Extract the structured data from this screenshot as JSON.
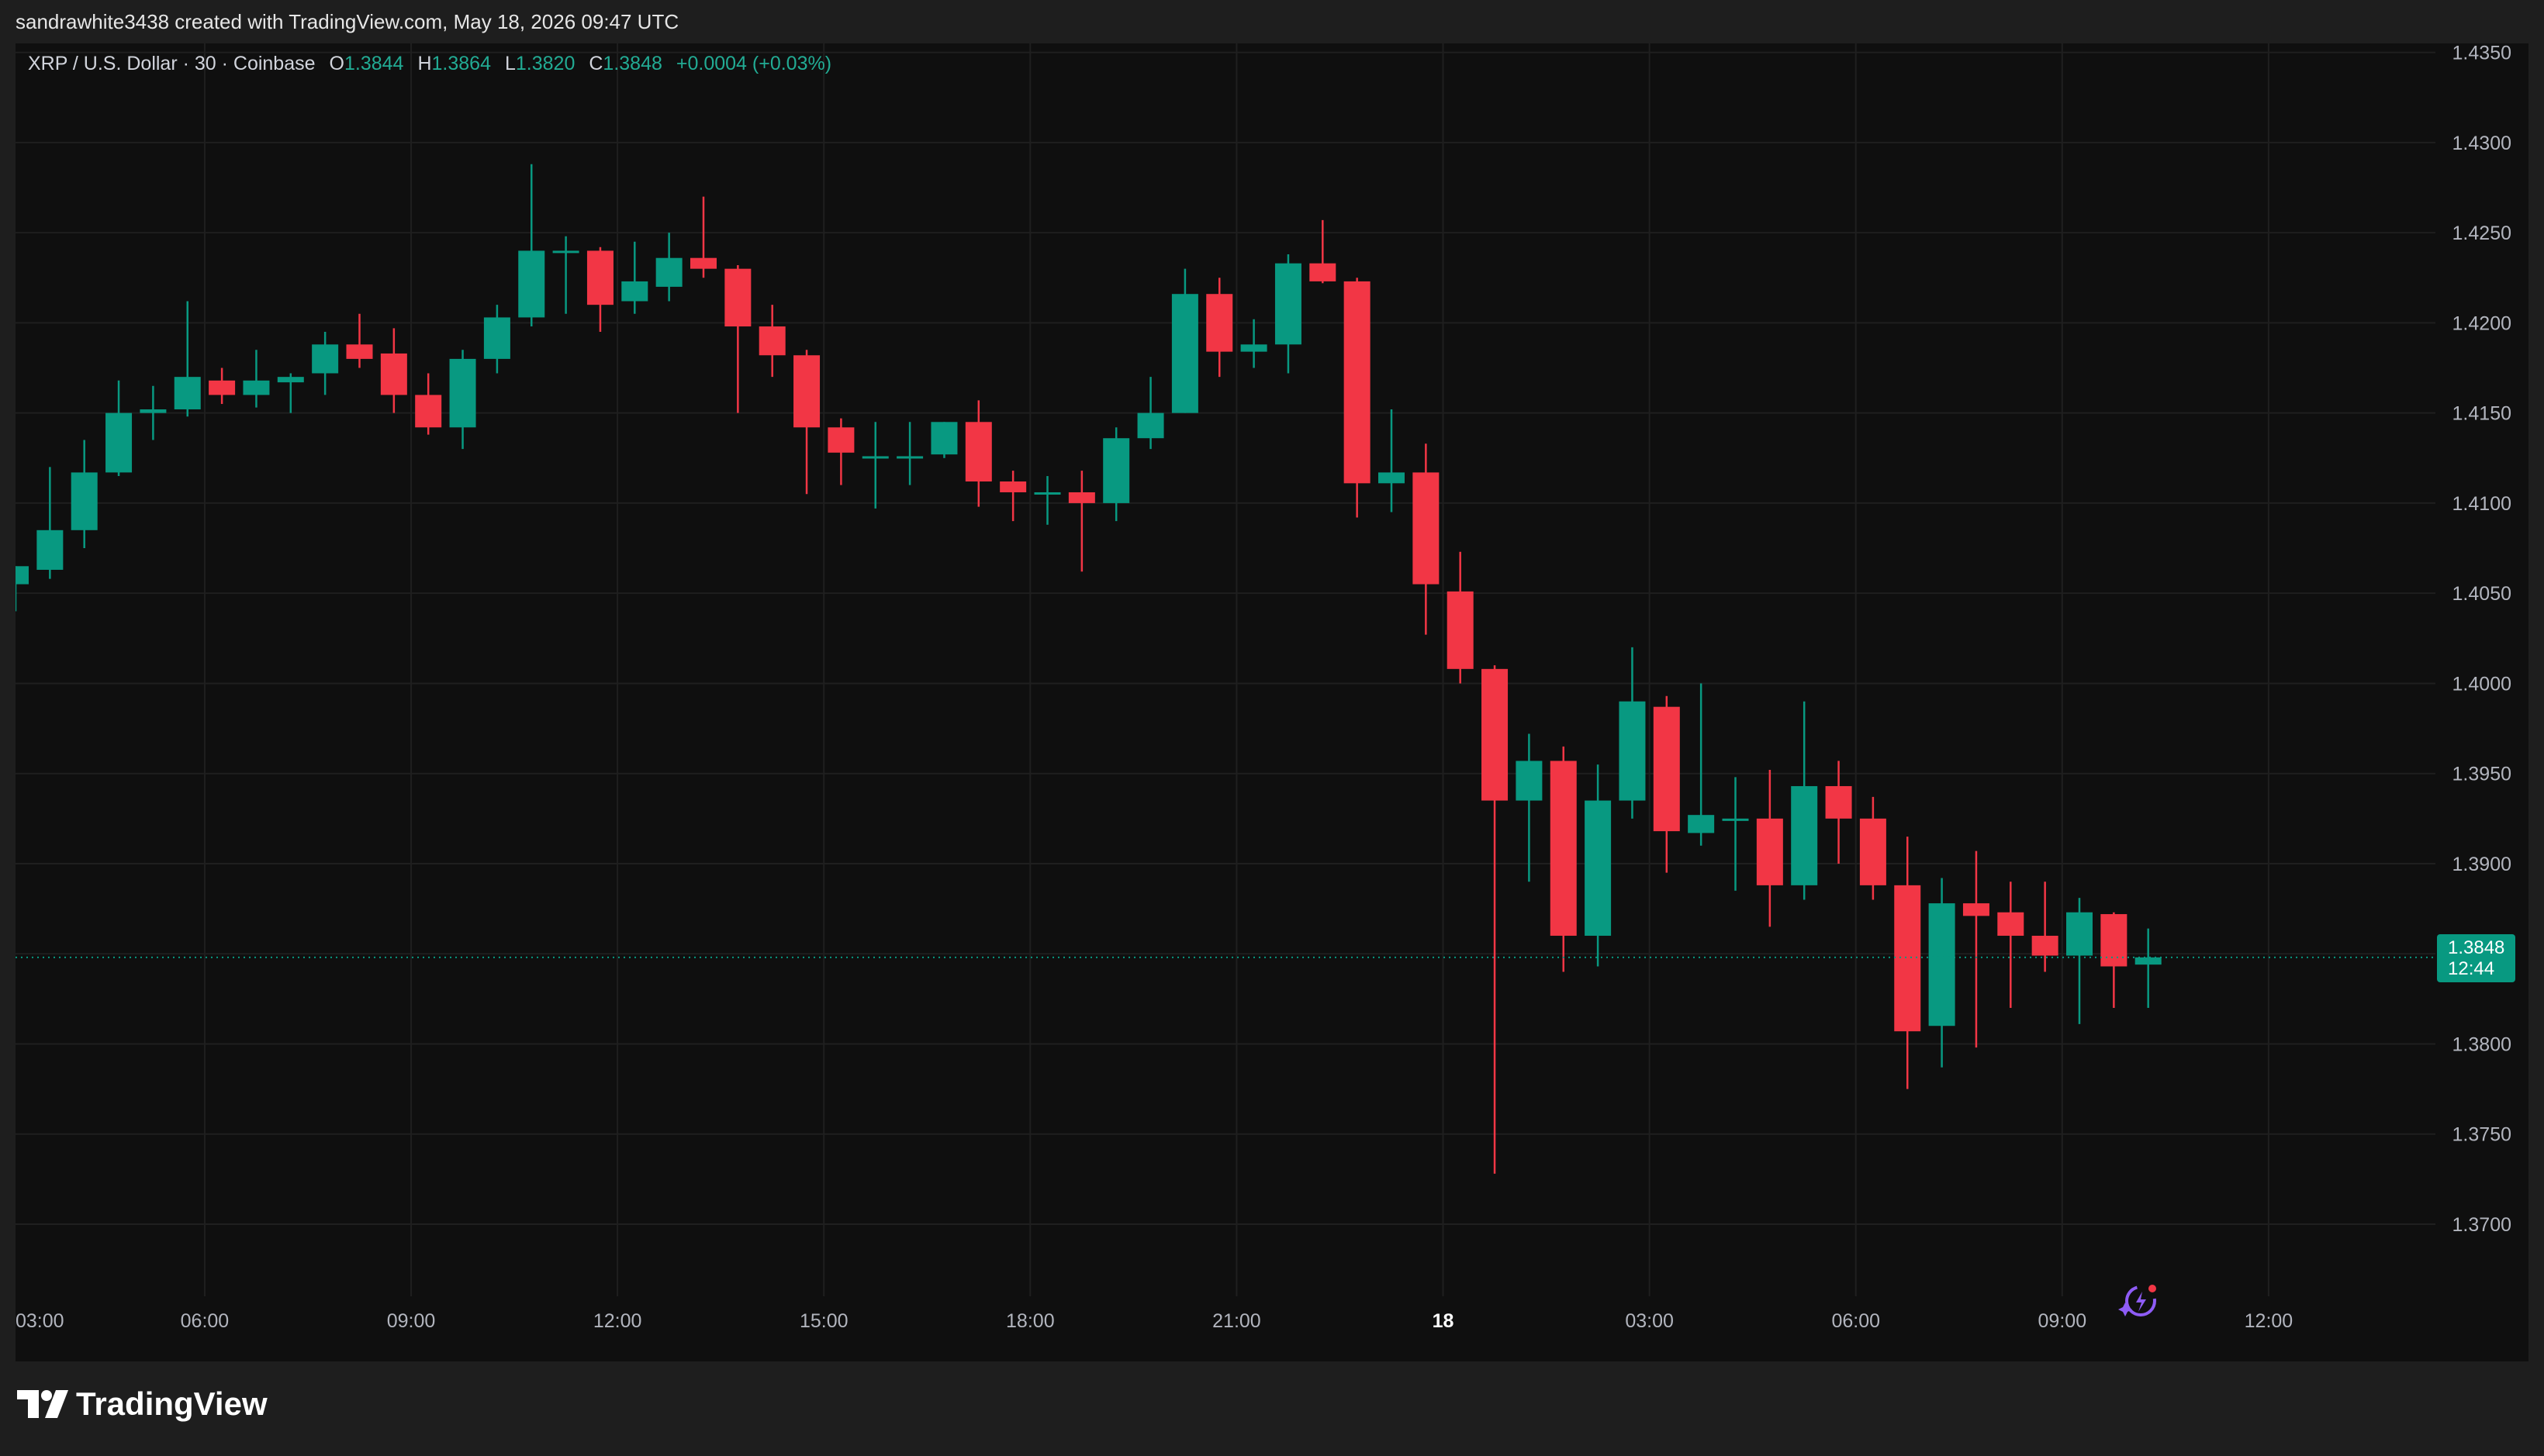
{
  "header": {
    "credit": "sandrawhite3438 created with TradingView.com, May 18, 2026 09:47 UTC"
  },
  "legend": {
    "symbol": "XRP / U.S. Dollar · 30 · Coinbase",
    "open_label": "O",
    "open": "1.3844",
    "high_label": "H",
    "high": "1.3864",
    "low_label": "L",
    "low": "1.3820",
    "close_label": "C",
    "close": "1.3848",
    "change": "+0.0004 (+0.03%)"
  },
  "price_tag": {
    "price": "1.3848",
    "countdown": "12:44"
  },
  "branding": {
    "logo_text": "TradingView"
  },
  "colors": {
    "up": "#089981",
    "down": "#f23645",
    "background": "#0f0f0f",
    "grid": "#1f1f1f",
    "axis_text": "#b2b5be"
  },
  "chart_data": {
    "type": "candlestick",
    "interval_minutes": 30,
    "y_ticks": [
      "1.4350",
      "1.4300",
      "1.4250",
      "1.4200",
      "1.4150",
      "1.4100",
      "1.4050",
      "1.4000",
      "1.3950",
      "1.3900",
      "1.3850",
      "1.3800",
      "1.3750",
      "1.3700"
    ],
    "ylim": [
      1.366,
      1.4355
    ],
    "x_tick_labels": [
      {
        "label": "03:00",
        "slot": -1
      },
      {
        "label": "06:00",
        "slot": 5
      },
      {
        "label": "09:00",
        "slot": 11
      },
      {
        "label": "12:00",
        "slot": 17
      },
      {
        "label": "15:00",
        "slot": 23
      },
      {
        "label": "18:00",
        "slot": 29
      },
      {
        "label": "21:00",
        "slot": 35
      },
      {
        "label": "18",
        "slot": 41,
        "bold": true
      },
      {
        "label": "03:00",
        "slot": 47
      },
      {
        "label": "06:00",
        "slot": 53
      },
      {
        "label": "09:00",
        "slot": 59
      },
      {
        "label": "12:00",
        "slot": 65
      }
    ],
    "candles": [
      {
        "o": 1.4055,
        "h": 1.4065,
        "l": 1.404,
        "c": 1.4065
      },
      {
        "o": 1.4063,
        "h": 1.412,
        "l": 1.4058,
        "c": 1.4085
      },
      {
        "o": 1.4085,
        "h": 1.4135,
        "l": 1.4075,
        "c": 1.4117
      },
      {
        "o": 1.4117,
        "h": 1.4168,
        "l": 1.4115,
        "c": 1.415
      },
      {
        "o": 1.415,
        "h": 1.4165,
        "l": 1.4135,
        "c": 1.4152
      },
      {
        "o": 1.4152,
        "h": 1.4212,
        "l": 1.4148,
        "c": 1.417
      },
      {
        "o": 1.4168,
        "h": 1.4175,
        "l": 1.4155,
        "c": 1.416
      },
      {
        "o": 1.416,
        "h": 1.4185,
        "l": 1.4153,
        "c": 1.4168
      },
      {
        "o": 1.4167,
        "h": 1.4172,
        "l": 1.415,
        "c": 1.417
      },
      {
        "o": 1.4172,
        "h": 1.4195,
        "l": 1.416,
        "c": 1.4188
      },
      {
        "o": 1.4188,
        "h": 1.4205,
        "l": 1.4175,
        "c": 1.418
      },
      {
        "o": 1.4183,
        "h": 1.4197,
        "l": 1.415,
        "c": 1.416
      },
      {
        "o": 1.416,
        "h": 1.4172,
        "l": 1.4138,
        "c": 1.4142
      },
      {
        "o": 1.4142,
        "h": 1.4185,
        "l": 1.413,
        "c": 1.418
      },
      {
        "o": 1.418,
        "h": 1.421,
        "l": 1.4172,
        "c": 1.4203
      },
      {
        "o": 1.4203,
        "h": 1.4288,
        "l": 1.4198,
        "c": 1.424
      },
      {
        "o": 1.424,
        "h": 1.4248,
        "l": 1.4205,
        "c": 1.424
      },
      {
        "o": 1.424,
        "h": 1.4242,
        "l": 1.4195,
        "c": 1.421
      },
      {
        "o": 1.4212,
        "h": 1.4245,
        "l": 1.4205,
        "c": 1.4223
      },
      {
        "o": 1.422,
        "h": 1.425,
        "l": 1.4212,
        "c": 1.4236
      },
      {
        "o": 1.4236,
        "h": 1.427,
        "l": 1.4225,
        "c": 1.423
      },
      {
        "o": 1.423,
        "h": 1.4232,
        "l": 1.415,
        "c": 1.4198
      },
      {
        "o": 1.4198,
        "h": 1.421,
        "l": 1.417,
        "c": 1.4182
      },
      {
        "o": 1.4182,
        "h": 1.4185,
        "l": 1.4105,
        "c": 1.4142
      },
      {
        "o": 1.4142,
        "h": 1.4147,
        "l": 1.411,
        "c": 1.4128
      },
      {
        "o": 1.4126,
        "h": 1.4145,
        "l": 1.4097,
        "c": 1.4126
      },
      {
        "o": 1.4126,
        "h": 1.4145,
        "l": 1.411,
        "c": 1.4126
      },
      {
        "o": 1.4127,
        "h": 1.4145,
        "l": 1.4125,
        "c": 1.4145
      },
      {
        "o": 1.4145,
        "h": 1.4157,
        "l": 1.4098,
        "c": 1.4112
      },
      {
        "o": 1.4112,
        "h": 1.4118,
        "l": 1.409,
        "c": 1.4106
      },
      {
        "o": 1.4106,
        "h": 1.4115,
        "l": 1.4088,
        "c": 1.4106
      },
      {
        "o": 1.4106,
        "h": 1.4118,
        "l": 1.4062,
        "c": 1.41
      },
      {
        "o": 1.41,
        "h": 1.4142,
        "l": 1.409,
        "c": 1.4136
      },
      {
        "o": 1.4136,
        "h": 1.417,
        "l": 1.413,
        "c": 1.415
      },
      {
        "o": 1.415,
        "h": 1.423,
        "l": 1.415,
        "c": 1.4216
      },
      {
        "o": 1.4216,
        "h": 1.4225,
        "l": 1.417,
        "c": 1.4184
      },
      {
        "o": 1.4184,
        "h": 1.4202,
        "l": 1.4175,
        "c": 1.4188
      },
      {
        "o": 1.4188,
        "h": 1.4238,
        "l": 1.4172,
        "c": 1.4233
      },
      {
        "o": 1.4233,
        "h": 1.4257,
        "l": 1.4222,
        "c": 1.4223
      },
      {
        "o": 1.4223,
        "h": 1.4225,
        "l": 1.4092,
        "c": 1.4111
      },
      {
        "o": 1.4111,
        "h": 1.4152,
        "l": 1.4095,
        "c": 1.4117
      },
      {
        "o": 1.4117,
        "h": 1.4133,
        "l": 1.4027,
        "c": 1.4055
      },
      {
        "o": 1.4051,
        "h": 1.4073,
        "l": 1.4,
        "c": 1.4008
      },
      {
        "o": 1.4008,
        "h": 1.401,
        "l": 1.3728,
        "c": 1.3935
      },
      {
        "o": 1.3935,
        "h": 1.3972,
        "l": 1.389,
        "c": 1.3957
      },
      {
        "o": 1.3957,
        "h": 1.3965,
        "l": 1.384,
        "c": 1.386
      },
      {
        "o": 1.386,
        "h": 1.3955,
        "l": 1.3843,
        "c": 1.3935
      },
      {
        "o": 1.3935,
        "h": 1.402,
        "l": 1.3925,
        "c": 1.399
      },
      {
        "o": 1.3987,
        "h": 1.3993,
        "l": 1.3895,
        "c": 1.3918
      },
      {
        "o": 1.3917,
        "h": 1.4,
        "l": 1.391,
        "c": 1.3927
      },
      {
        "o": 1.3925,
        "h": 1.3948,
        "l": 1.3885,
        "c": 1.3925
      },
      {
        "o": 1.3925,
        "h": 1.3952,
        "l": 1.3865,
        "c": 1.3888
      },
      {
        "o": 1.3888,
        "h": 1.399,
        "l": 1.388,
        "c": 1.3943
      },
      {
        "o": 1.3943,
        "h": 1.3957,
        "l": 1.39,
        "c": 1.3925
      },
      {
        "o": 1.3925,
        "h": 1.3937,
        "l": 1.388,
        "c": 1.3888
      },
      {
        "o": 1.3888,
        "h": 1.3915,
        "l": 1.3775,
        "c": 1.3807
      },
      {
        "o": 1.381,
        "h": 1.3892,
        "l": 1.3787,
        "c": 1.3878
      },
      {
        "o": 1.3878,
        "h": 1.3907,
        "l": 1.3798,
        "c": 1.3871
      },
      {
        "o": 1.3873,
        "h": 1.389,
        "l": 1.382,
        "c": 1.386
      },
      {
        "o": 1.386,
        "h": 1.389,
        "l": 1.384,
        "c": 1.3849
      },
      {
        "o": 1.3849,
        "h": 1.3881,
        "l": 1.3811,
        "c": 1.3873
      },
      {
        "o": 1.3872,
        "h": 1.3873,
        "l": 1.382,
        "c": 1.3843
      },
      {
        "o": 1.3844,
        "h": 1.3864,
        "l": 1.382,
        "c": 1.3848
      }
    ]
  }
}
